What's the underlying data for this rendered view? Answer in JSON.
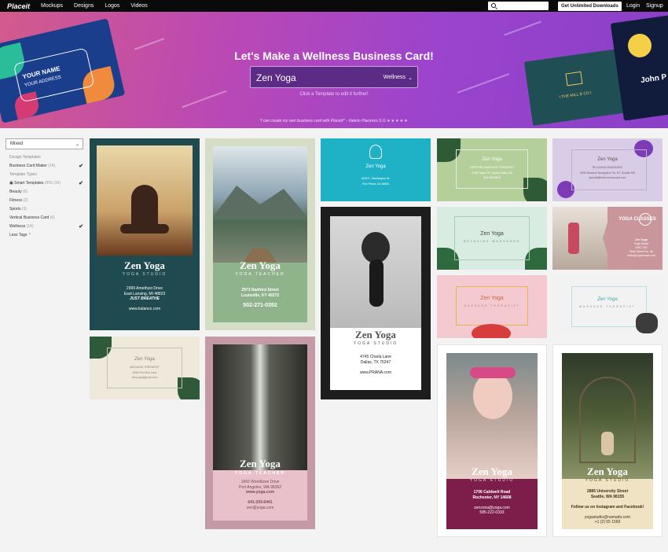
{
  "nav": {
    "logo": "Placeit",
    "links": [
      "Mockups",
      "Designs",
      "Logos",
      "Videos"
    ],
    "unlimited": "Get Unlimited Downloads",
    "login": "Login",
    "signup": "Signup"
  },
  "hero": {
    "title": "Let's Make a Wellness Business Card!",
    "input_value": "Zen Yoga",
    "category": "Wellness",
    "hint": "Click a Template to edit it further!",
    "quote": "\"I can create my own business card with Placeit!\" - Valerio Piacenzo S.G",
    "stars": "★★★★★",
    "left_card_name": "YOUR NAME",
    "left_card_addr": "YOUR ADDRESS",
    "mid_card_text": "I THE MILL B CO I",
    "right_card_text": "John P"
  },
  "sidebar": {
    "sort": "Mixed",
    "design_templates_head": "Design Templates",
    "business_card_maker": "Business Card Maker",
    "business_card_count": "(14)",
    "template_types_head": "Template Types",
    "smart_templates": "Smart Templates",
    "smart_sub": "JPG",
    "smart_count": "(14)",
    "beauty": "Beauty",
    "beauty_count": "(6)",
    "fitness": "Fitness",
    "fitness_count": "(2)",
    "sports": "Sports",
    "sports_count": "(3)",
    "vertical": "Vertical Business Card",
    "vertical_count": "(6)",
    "wellness": "Wellness",
    "wellness_count": "(14)",
    "less_tags": "Less Tags"
  },
  "cards": {
    "c1": {
      "name": "Zen Yoga",
      "sub": "YOGA STUDIO",
      "addr1": "2999 Amethyst Drive",
      "addr2": "East Lansing, MI 48823",
      "tag": "JUST BREATHE",
      "web": "www.balance.com"
    },
    "c2": {
      "name": "Zen Yoga",
      "sub": "YOGA TEACHER",
      "addr1": "2973 Radford Street",
      "addr2": "Louisville, KY 40272",
      "phone": "502-271-0352"
    },
    "c3": {
      "name": "Zen Yoga",
      "sub": "YOGA STUDIO",
      "l1": "4745 Charla Lane",
      "l2": "Dallas, TX 75247",
      "l3": "www.PRANA.com"
    },
    "c4": {
      "name": "Zen Yoga",
      "sub": "YOGA TEACHER",
      "l1": "1843 Woodlawn Drive",
      "l2": "Port Angeles, WA 98362",
      "web": "www.yoga.com",
      "phone": "641-203-6441",
      "mail": "zen@yoga.com"
    },
    "c5": {
      "name": "Zen Yoga",
      "sub": "YOGA STUDIO",
      "l1": "1706 Caldwell Road",
      "l2": "Rochester, NY 14608",
      "mail": "zenzona@yoga.com",
      "phone": "585-222-0333"
    },
    "c6": {
      "name": "Zen Yoga",
      "sub": "YOGA STUDIO",
      "l1": "2885 University Street",
      "l2": "Seattle, WA 98155",
      "follow": "Follow us on Instagram and Facebook!",
      "mail": "yogastudio@namado.com",
      "phone": "+1 (2) 55 1569"
    },
    "h1": {
      "name": "Zen Yoga",
      "l1": "4525 E. Washington St.",
      "l2": "Port Pierce, MI 48839"
    },
    "h2": {
      "name": "Zen Yoga",
      "sub": "CERTIFIED MASSAGE THERAPIST",
      "l1": "4745 Taylor Rd, Spring Valley, MI",
      "l2": "503-503-5533"
    },
    "h3": {
      "name": "Zen Yoga",
      "sub": "RELAXING MASSAGES",
      "l1": "4635 Meadow Navigation Rd, BT, Seattle WA",
      "l2": "gemail@thebusinesscard.com"
    },
    "h4": {
      "name": "Zen Yoga",
      "sub": "RELAXING MASSAGES"
    },
    "h5": {
      "title": "YOGA CLASSES",
      "name": "Zen Yoga",
      "l1": "Yoga Studio",
      "l2": "WSC 300",
      "l3": "Main Street No. 34",
      "l4": "hello@yogamrace.com"
    },
    "h6": {
      "name": "Zen Yoga",
      "sub": "MASSAGE THERAPIST"
    },
    "h7": {
      "name": "Zen Yoga",
      "sub": "MASSAGE THERAPIST"
    },
    "h8": {
      "name": "Zen Yoga",
      "sub": "MASSAGE THERAPIST",
      "l1": "1856 Red Bud Lane",
      "l2": "zenyoga@gmail.com"
    }
  }
}
